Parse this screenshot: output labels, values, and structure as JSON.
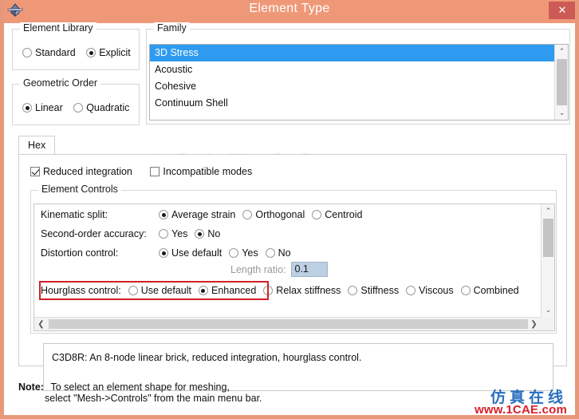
{
  "window": {
    "title": "Element Type",
    "app_icon": "diamond-icon",
    "close_label": "✕",
    "titlebar_color": "#ef9878",
    "close_color": "#cc5a55"
  },
  "element_library": {
    "legend": "Element Library",
    "options": [
      {
        "label": "Standard",
        "selected": false
      },
      {
        "label": "Explicit",
        "selected": true
      }
    ]
  },
  "geometric_order": {
    "legend": "Geometric Order",
    "options": [
      {
        "label": "Linear",
        "selected": true
      },
      {
        "label": "Quadratic",
        "selected": false
      }
    ]
  },
  "family": {
    "legend": "Family",
    "items": [
      {
        "label": "3D Stress",
        "selected": true
      },
      {
        "label": "Acoustic",
        "selected": false
      },
      {
        "label": "Cohesive",
        "selected": false
      },
      {
        "label": "Continuum Shell",
        "selected": false
      }
    ],
    "scroll_up": "⌃",
    "scroll_down": "⌄",
    "selection_color": "#2e9bf0"
  },
  "tabs": [
    {
      "label": "Hex",
      "active": true
    }
  ],
  "checkboxes": [
    {
      "label": "Reduced integration",
      "checked": true
    },
    {
      "label": "Incompatible modes",
      "checked": false
    }
  ],
  "element_controls": {
    "legend": "Element Controls",
    "rows": [
      {
        "label": "Kinematic split:",
        "options": [
          {
            "label": "Average strain",
            "selected": true
          },
          {
            "label": "Orthogonal",
            "selected": false
          },
          {
            "label": "Centroid",
            "selected": false
          }
        ]
      },
      {
        "label": "Second-order accuracy:",
        "options": [
          {
            "label": "Yes",
            "selected": false
          },
          {
            "label": "No",
            "selected": true
          }
        ]
      },
      {
        "label": "Distortion control:",
        "options": [
          {
            "label": "Use default",
            "selected": true
          },
          {
            "label": "Yes",
            "selected": false
          },
          {
            "label": "No",
            "selected": false
          }
        ]
      }
    ],
    "length_ratio": {
      "label": "Length ratio:",
      "value": "0.1",
      "disabled": true
    },
    "hourglass": {
      "label": "Hourglass control:",
      "options": [
        {
          "label": "Use default",
          "selected": false
        },
        {
          "label": "Enhanced",
          "selected": true
        },
        {
          "label": "Relax stiffness",
          "selected": false
        },
        {
          "label": "Stiffness",
          "selected": false
        },
        {
          "label": "Viscous",
          "selected": false
        },
        {
          "label": "Combined",
          "selected": false
        }
      ],
      "highlight_color": "#d21f28"
    },
    "scroll_up": "⌃",
    "scroll_down": "⌄",
    "scroll_left": "❮",
    "scroll_right": "❯"
  },
  "description": "C3D8R:  An 8-node linear brick, reduced integration, hourglass control.",
  "note": {
    "label": "Note:",
    "line1": "To select an element shape for meshing,",
    "line2": "select \"Mesh->Controls\" from the main menu bar."
  },
  "watermark": {
    "chinese": "仿真在线",
    "url": "www.1CAE.com",
    "ghost": "1CAE.COM"
  }
}
